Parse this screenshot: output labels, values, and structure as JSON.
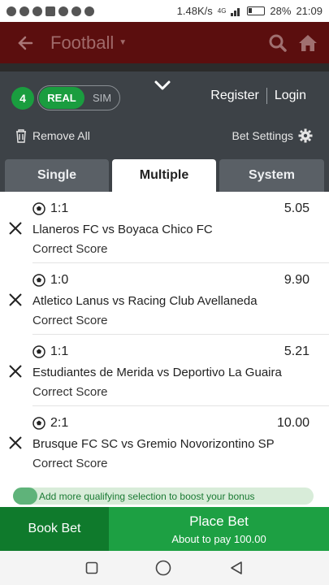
{
  "status_bar": {
    "speed": "1.48K/s",
    "network": "4G",
    "battery": "28%",
    "time": "21:09"
  },
  "header": {
    "title": "Football"
  },
  "betslip": {
    "count": "4",
    "mode_real": "REAL",
    "mode_sim": "SIM",
    "register": "Register",
    "login": "Login",
    "remove_all": "Remove All",
    "bet_settings": "Bet Settings"
  },
  "tabs": [
    {
      "label": "Single",
      "active": false
    },
    {
      "label": "Multiple",
      "active": true
    },
    {
      "label": "System",
      "active": false
    }
  ],
  "bets": [
    {
      "score": "1:1",
      "odds": "5.05",
      "match": "Llaneros FC vs Boyaca Chico FC",
      "market": "Correct Score"
    },
    {
      "score": "1:0",
      "odds": "9.90",
      "match": "Atletico Lanus vs Racing Club Avellaneda",
      "market": "Correct Score"
    },
    {
      "score": "1:1",
      "odds": "5.21",
      "match": "Estudiantes de Merida vs Deportivo La Guaira",
      "market": "Correct Score"
    },
    {
      "score": "2:1",
      "odds": "10.00",
      "match": "Brusque FC SC vs Gremio Novorizontino SP",
      "market": "Correct Score"
    }
  ],
  "bonus": {
    "text": "Add more qualifying selection to boost your bonus"
  },
  "actions": {
    "book_bet": "Book Bet",
    "place_bet": "Place Bet",
    "pay_text": "About to pay 100.00"
  },
  "colors": {
    "header_bg": "#5b0e0e",
    "panel_bg": "#3d4247",
    "accent_green": "#1da043",
    "dark_green": "#0f7a2c"
  }
}
